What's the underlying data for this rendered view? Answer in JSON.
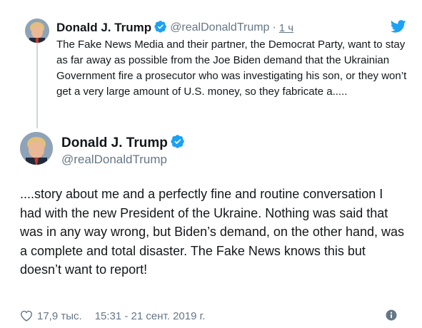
{
  "parent_tweet": {
    "display_name": "Donald J. Trump",
    "handle": "@realDonaldTrump",
    "separator": "·",
    "time": "1 ч",
    "text": "The Fake News Media and their partner, the Democrat Party, want to stay as far away as possible from the Joe Biden demand that the Ukrainian Government fire a prosecutor who was investigating his son, or they won’t get a very large amount of U.S. money, so they fabricate a.....",
    "avatar_icon": "profile-photo",
    "verified_icon": "verified-badge-icon",
    "brand_icon": "twitter-bird-icon"
  },
  "main_tweet": {
    "display_name": "Donald J. Trump",
    "handle": "@realDonaldTrump",
    "text": "....story about me and a perfectly fine and routine conversation I had with the new President of the Ukraine. Nothing was said that was in any way wrong, but Biden’s demand, on the other hand, was a complete and total disaster. The Fake News knows this but doesn’t want to report!",
    "likes": "17,9 тыс.",
    "timestamp": "15:31 - 21 сент. 2019 г.",
    "heart_icon": "heart-icon",
    "info_icon": "info-icon"
  },
  "colors": {
    "text": "#14171a",
    "secondary": "#657786",
    "brand_blue": "#1da1f2",
    "thread_line": "#ccd6dd"
  }
}
